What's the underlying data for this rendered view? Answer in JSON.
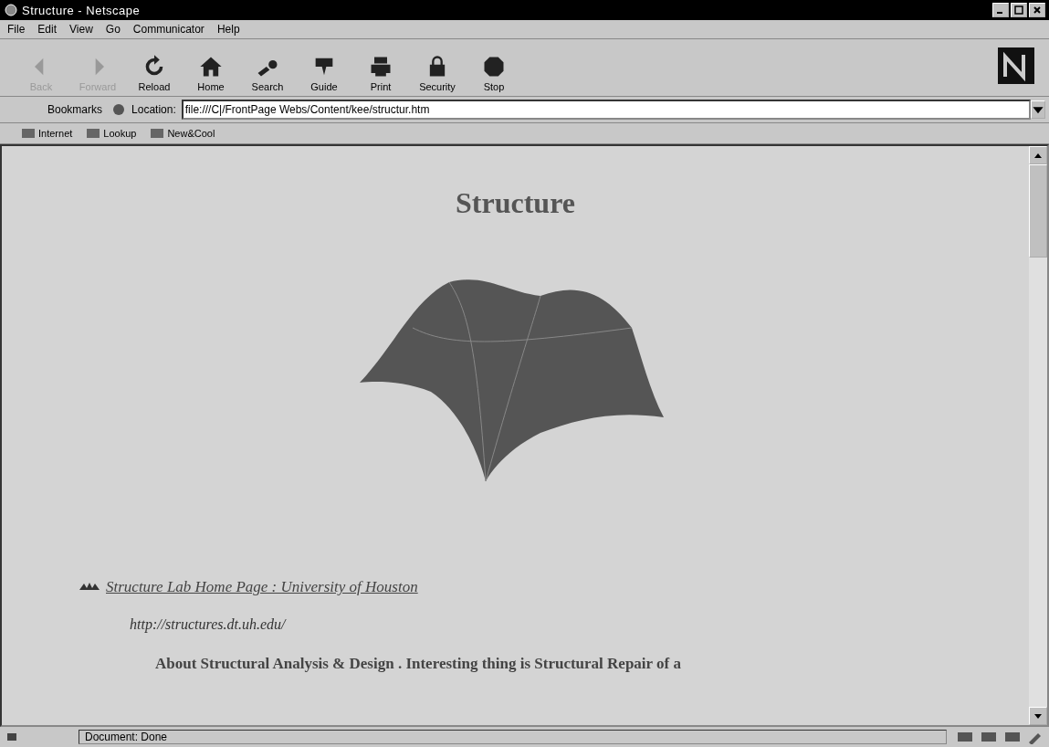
{
  "window": {
    "title": "Structure - Netscape"
  },
  "menu": [
    "File",
    "Edit",
    "View",
    "Go",
    "Communicator",
    "Help"
  ],
  "toolbar": [
    {
      "label": "Back",
      "disabled": true
    },
    {
      "label": "Forward",
      "disabled": true
    },
    {
      "label": "Reload",
      "disabled": false
    },
    {
      "label": "Home",
      "disabled": false
    },
    {
      "label": "Search",
      "disabled": false
    },
    {
      "label": "Guide",
      "disabled": false
    },
    {
      "label": "Print",
      "disabled": false
    },
    {
      "label": "Security",
      "disabled": false
    },
    {
      "label": "Stop",
      "disabled": false
    }
  ],
  "location_bar": {
    "bookmarks": "Bookmarks",
    "location_label": "Location:",
    "url": "file:///C|/FrontPage Webs/Content/kee/structur.htm"
  },
  "personal_toolbar": [
    "Internet",
    "Lookup",
    "New&Cool"
  ],
  "page": {
    "heading": "Structure",
    "link": "Structure Lab Home Page : University of Houston",
    "url_text": "http://structures.dt.uh.edu/",
    "bold_line": "About Structural Analysis & Design . Interesting thing is Structural Repair of a"
  },
  "status_bar": {
    "text": "Document: Done"
  }
}
